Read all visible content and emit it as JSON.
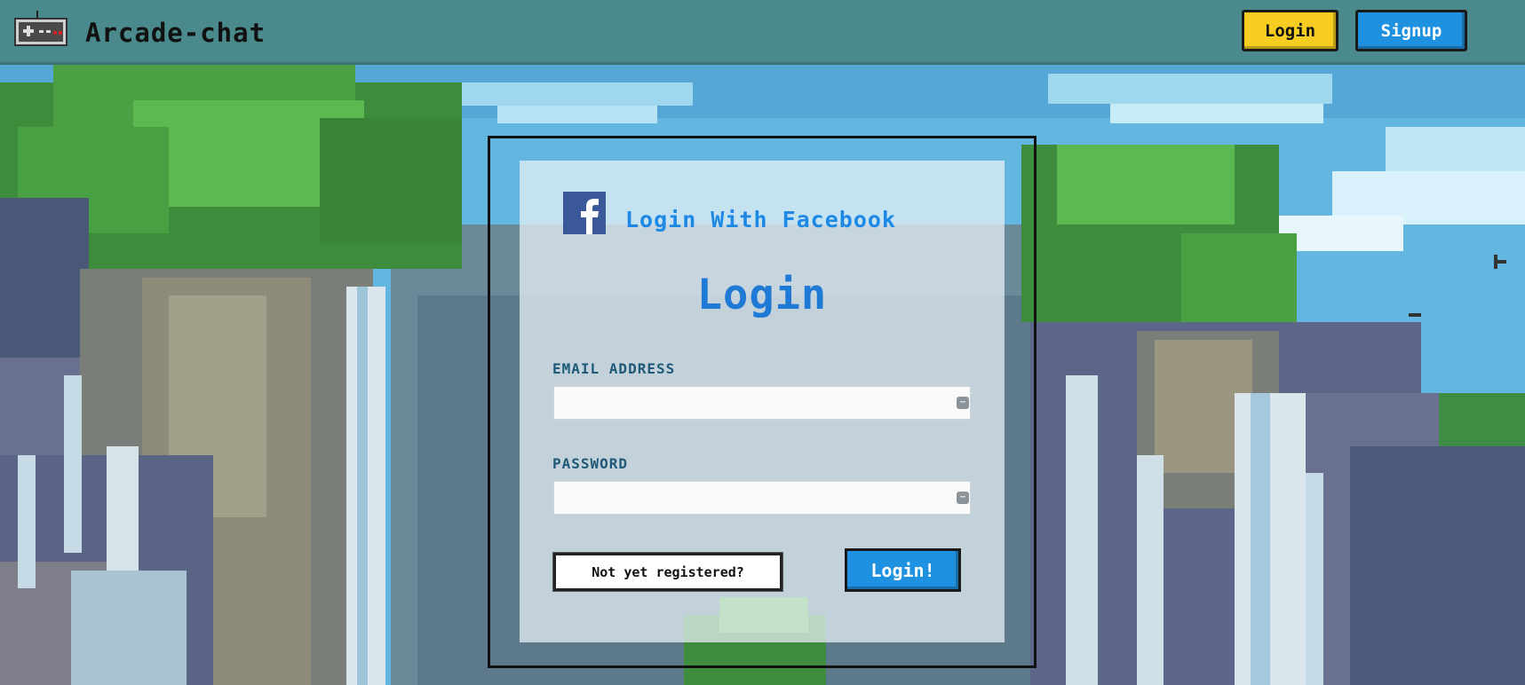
{
  "header": {
    "title": "Arcade-chat",
    "logo_icon": "gamepad-icon",
    "login_label": "Login",
    "signup_label": "Signup"
  },
  "login_form": {
    "facebook_icon": "facebook-icon",
    "facebook_label": "Login With Facebook",
    "title": "Login",
    "email_label": "EMAIL ADDRESS",
    "email_value": "",
    "password_label": "PASSWORD",
    "password_value": "",
    "register_label": "Not yet registered?",
    "submit_label": "Login!"
  },
  "colors": {
    "navbar": "#4a8a8c",
    "login_button": "#f6cd20",
    "signup_button": "#1e92e0",
    "accent_blue": "#1e7ad4"
  }
}
